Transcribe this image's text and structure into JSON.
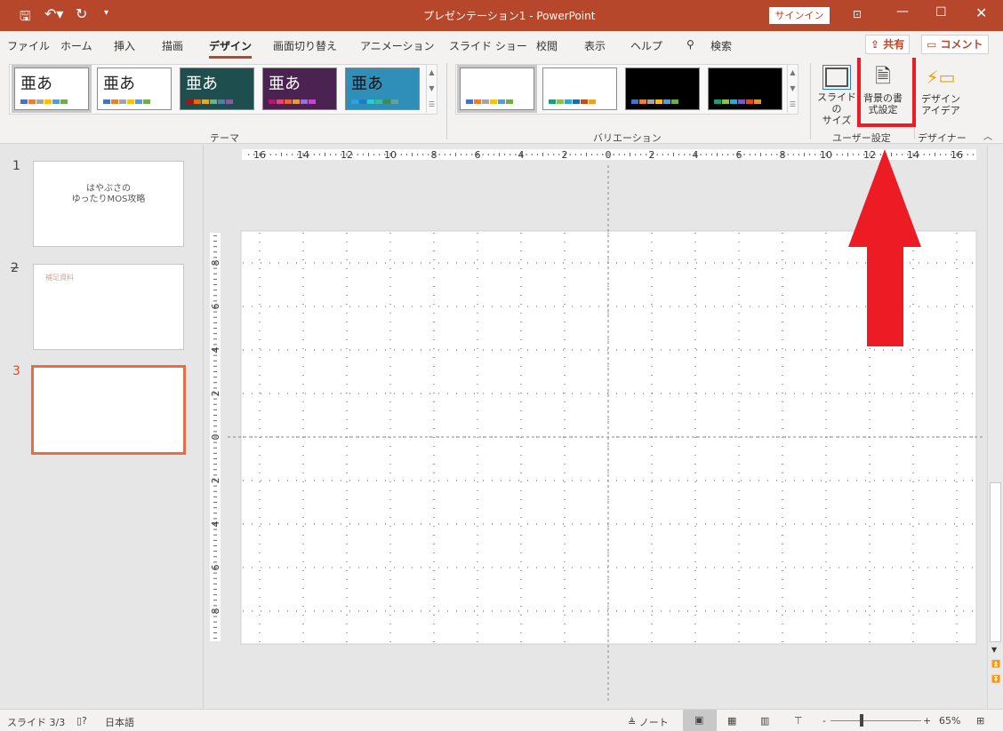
{
  "titlebar": {
    "title": "プレゼンテーション1  -  PowerPoint",
    "signin": "サインイン",
    "icons": [
      "save-icon",
      "undo-icon",
      "redo-icon",
      "customize-icon",
      "ribbon-display-icon",
      "minimize-icon",
      "maximize-icon",
      "close-icon"
    ]
  },
  "tabs": [
    "ファイル",
    "ホーム",
    "挿入",
    "描画",
    "デザイン",
    "画面切り替え",
    "アニメーション",
    "スライド ショー",
    "校閲",
    "表示",
    "ヘルプ",
    "検索"
  ],
  "active_tab": "デザイン",
  "share": "共有",
  "comment": "コメント",
  "ribbon": {
    "themes_label": "テーマ",
    "theme_glyph": "亜あ",
    "themes": [
      {
        "bg": "#ffffff",
        "fg": "#222",
        "colors": [
          "#4472c4",
          "#ed7d31",
          "#a5a5a5",
          "#ffc000",
          "#5b9bd5",
          "#70ad47"
        ]
      },
      {
        "bg": "#ffffff",
        "fg": "#222",
        "colors": [
          "#4472c4",
          "#ed7d31",
          "#a5a5a5",
          "#ffc000",
          "#5b9bd5",
          "#70ad47"
        ]
      },
      {
        "bg": "#1f4e4f",
        "fg": "#fff",
        "colors": [
          "#a4161a",
          "#e36c0a",
          "#e2ac23",
          "#6fb08f",
          "#4f81a0",
          "#8a5a9f"
        ]
      },
      {
        "bg": "#4a2350",
        "fg": "#fff",
        "colors": [
          "#b01a6e",
          "#e0457b",
          "#e8633a",
          "#e59a3b",
          "#9b6ce0",
          "#c845d0"
        ]
      },
      {
        "bg": "#2f8fb8",
        "fg": "#111",
        "colors": [
          "#2aa4dd",
          "#1d7ec4",
          "#2bc9d0",
          "#3cb89b",
          "#3a8a5a",
          "#5fa2a0"
        ]
      }
    ],
    "variations_label": "バリエーション",
    "variations": [
      {
        "bg": "#ffffff",
        "colors": [
          "#4472c4",
          "#ed7d31",
          "#a5a5a5",
          "#ffc000",
          "#5b9bd5",
          "#70ad47"
        ]
      },
      {
        "bg": "#ffffff",
        "colors": [
          "#1e9b7a",
          "#8bc34a",
          "#2ca9c9",
          "#1e6bb0",
          "#c0501a",
          "#f0a020"
        ]
      },
      {
        "bg": "#000000",
        "colors": [
          "#4472c4",
          "#ed7d31",
          "#a5a5a5",
          "#ffc000",
          "#5b9bd5",
          "#70ad47"
        ]
      },
      {
        "bg": "#000000",
        "colors": [
          "#1e9b7a",
          "#8bc34a",
          "#2ca9c9",
          "#7e57c2",
          "#d84a2a",
          "#e0962a"
        ]
      }
    ],
    "slide_size": "スライドの\nサイズ",
    "format_background": "背景の書\n式設定",
    "user_settings_label": "ユーザー設定",
    "design_ideas": "デザイン\nアイデア",
    "designer_label": "デザイナー"
  },
  "slides": [
    {
      "number": "1",
      "line1": "はやぶさの",
      "line2": "ゆったりMOS攻略"
    },
    {
      "number": "2",
      "text": "補足資料"
    },
    {
      "number": "3"
    }
  ],
  "active_slide": 3,
  "ruler": {
    "horizontal": [
      "16",
      "14",
      "12",
      "10",
      "8",
      "6",
      "4",
      "2",
      "0",
      "2",
      "4",
      "6",
      "8",
      "10",
      "12",
      "14",
      "16"
    ],
    "vertical": [
      "8",
      "6",
      "4",
      "2",
      "0",
      "2",
      "4",
      "6",
      "8"
    ]
  },
  "status": {
    "slide": "スライド 3/3",
    "language": "日本語",
    "notes": "ノート",
    "zoom": "65%",
    "zoom_percent": 65
  },
  "annotation_color": "#ed1c24",
  "accent": "#b7472a"
}
